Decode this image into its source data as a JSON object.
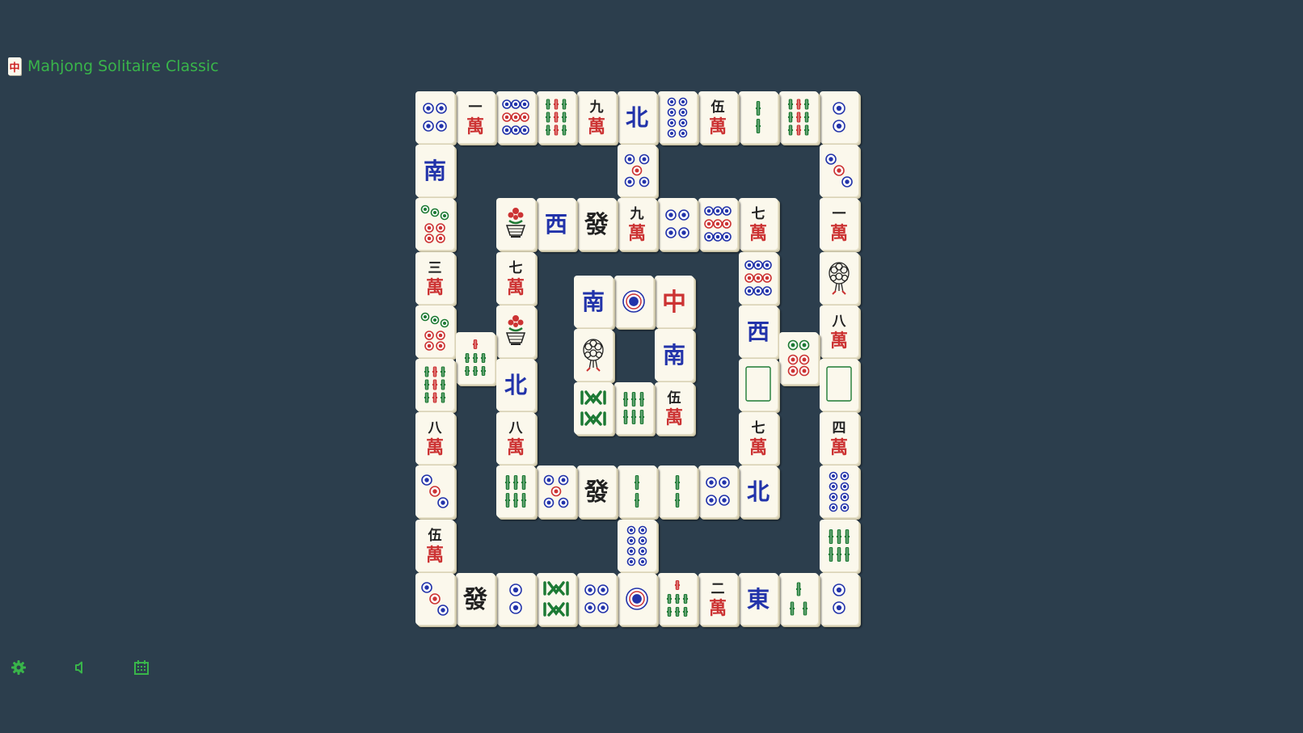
{
  "app": {
    "title": "Mahjong Solitaire Classic",
    "logo_glyph": "中",
    "logo_icon": "mahjong-red-dragon-logo-icon"
  },
  "colors": {
    "background": "#2c3e4d",
    "accent": "#39b54a",
    "tile_face": "#fbf8ec",
    "red": "#cc3333",
    "blue": "#2233aa",
    "green": "#1d7a34",
    "black": "#222222"
  },
  "toolbar": [
    {
      "name": "settings-button",
      "icon": "gear-icon"
    },
    {
      "name": "sound-button",
      "icon": "speaker-icon"
    },
    {
      "name": "calendar-button",
      "icon": "calendar-icon"
    }
  ],
  "tiles": [
    {
      "col": 0,
      "row": 0,
      "z": 0,
      "kind": "dots",
      "n": 4
    },
    {
      "col": 1,
      "row": 0,
      "z": 0,
      "kind": "char",
      "n": 1
    },
    {
      "col": 2,
      "row": 0,
      "z": 0,
      "kind": "dots",
      "n": 9
    },
    {
      "col": 3,
      "row": 0,
      "z": 0,
      "kind": "bam",
      "n": 9
    },
    {
      "col": 4,
      "row": 0,
      "z": 0,
      "kind": "char",
      "n": 9
    },
    {
      "col": 5,
      "row": 0,
      "z": 0,
      "kind": "wind",
      "g": "北"
    },
    {
      "col": 6,
      "row": 0,
      "z": 0,
      "kind": "dots",
      "n": 8
    },
    {
      "col": 7,
      "row": 0,
      "z": 0,
      "kind": "char",
      "n": 5
    },
    {
      "col": 8,
      "row": 0,
      "z": 0,
      "kind": "bam",
      "n": 2
    },
    {
      "col": 9,
      "row": 0,
      "z": 0,
      "kind": "bam",
      "n": 9
    },
    {
      "col": 10,
      "row": 0,
      "z": 0,
      "kind": "dots",
      "n": 2
    },
    {
      "col": 0,
      "row": 1,
      "z": 0,
      "kind": "wind",
      "g": "南"
    },
    {
      "col": 5,
      "row": 1,
      "z": 0,
      "kind": "dots",
      "n": 5
    },
    {
      "col": 10,
      "row": 1,
      "z": 0,
      "kind": "dots",
      "n": 3
    },
    {
      "col": 0,
      "row": 2,
      "z": 0,
      "kind": "dots",
      "n": 7
    },
    {
      "col": 2,
      "row": 2,
      "z": 0,
      "kind": "flower",
      "v": "basket"
    },
    {
      "col": 3,
      "row": 2,
      "z": 0,
      "kind": "wind",
      "g": "西"
    },
    {
      "col": 4,
      "row": 2,
      "z": 0,
      "kind": "dragon",
      "c": "green"
    },
    {
      "col": 5,
      "row": 2,
      "z": 0,
      "kind": "char",
      "n": 9
    },
    {
      "col": 6,
      "row": 2,
      "z": 0,
      "kind": "dots",
      "n": 4
    },
    {
      "col": 7,
      "row": 2,
      "z": 0,
      "kind": "dots",
      "n": 9
    },
    {
      "col": 8,
      "row": 2,
      "z": 0,
      "kind": "char",
      "n": 7
    },
    {
      "col": 10,
      "row": 2,
      "z": 0,
      "kind": "char",
      "n": 1
    },
    {
      "col": 0,
      "row": 3,
      "z": 0,
      "kind": "char",
      "n": 3
    },
    {
      "col": 2,
      "row": 3,
      "z": 0,
      "kind": "char",
      "n": 7
    },
    {
      "col": 8,
      "row": 3,
      "z": 0,
      "kind": "dots",
      "n": 9
    },
    {
      "col": 10,
      "row": 3,
      "z": 0,
      "kind": "flower",
      "v": "tree"
    },
    {
      "col": 0,
      "row": 4,
      "z": 0,
      "kind": "dots",
      "n": 7
    },
    {
      "col": 2,
      "row": 4,
      "z": 0,
      "kind": "flower",
      "v": "basket"
    },
    {
      "col": 8,
      "row": 4,
      "z": 0,
      "kind": "wind",
      "g": "西"
    },
    {
      "col": 10,
      "row": 4,
      "z": 0,
      "kind": "char",
      "n": 8
    },
    {
      "col": 0,
      "row": 5,
      "z": 0,
      "kind": "bam",
      "n": 9
    },
    {
      "col": 2,
      "row": 5,
      "z": 0,
      "kind": "wind",
      "g": "北"
    },
    {
      "col": 8,
      "row": 5,
      "z": 0,
      "kind": "dragon",
      "c": "white"
    },
    {
      "col": 10,
      "row": 5,
      "z": 0,
      "kind": "dragon",
      "c": "white"
    },
    {
      "col": 0,
      "row": 6,
      "z": 0,
      "kind": "char",
      "n": 8
    },
    {
      "col": 2,
      "row": 6,
      "z": 0,
      "kind": "char",
      "n": 8
    },
    {
      "col": 8,
      "row": 6,
      "z": 0,
      "kind": "char",
      "n": 7
    },
    {
      "col": 10,
      "row": 6,
      "z": 0,
      "kind": "char",
      "n": 4
    },
    {
      "col": 0,
      "row": 7,
      "z": 0,
      "kind": "dots",
      "n": 3
    },
    {
      "col": 2,
      "row": 7,
      "z": 0,
      "kind": "bam",
      "n": 6
    },
    {
      "col": 3,
      "row": 7,
      "z": 0,
      "kind": "dots",
      "n": 5
    },
    {
      "col": 4,
      "row": 7,
      "z": 0,
      "kind": "dragon",
      "c": "green"
    },
    {
      "col": 5,
      "row": 7,
      "z": 0,
      "kind": "bam",
      "n": 2
    },
    {
      "col": 6,
      "row": 7,
      "z": 0,
      "kind": "bam",
      "n": 2
    },
    {
      "col": 7,
      "row": 7,
      "z": 0,
      "kind": "dots",
      "n": 4
    },
    {
      "col": 8,
      "row": 7,
      "z": 0,
      "kind": "wind",
      "g": "北"
    },
    {
      "col": 10,
      "row": 7,
      "z": 0,
      "kind": "dots",
      "n": 8
    },
    {
      "col": 0,
      "row": 8,
      "z": 0,
      "kind": "char",
      "n": 5
    },
    {
      "col": 5,
      "row": 8,
      "z": 0,
      "kind": "dots",
      "n": 8
    },
    {
      "col": 10,
      "row": 8,
      "z": 0,
      "kind": "bam",
      "n": 6
    },
    {
      "col": 0,
      "row": 9,
      "z": 0,
      "kind": "dots",
      "n": 3
    },
    {
      "col": 1,
      "row": 9,
      "z": 0,
      "kind": "dragon",
      "c": "green"
    },
    {
      "col": 2,
      "row": 9,
      "z": 0,
      "kind": "dots",
      "n": 2
    },
    {
      "col": 3,
      "row": 9,
      "z": 0,
      "kind": "bam",
      "n": 8
    },
    {
      "col": 4,
      "row": 9,
      "z": 0,
      "kind": "dots",
      "n": 4
    },
    {
      "col": 5,
      "row": 9,
      "z": 0,
      "kind": "dots",
      "n": 1
    },
    {
      "col": 6,
      "row": 9,
      "z": 0,
      "kind": "bam",
      "n": 7
    },
    {
      "col": 7,
      "row": 9,
      "z": 0,
      "kind": "char",
      "n": 2
    },
    {
      "col": 8,
      "row": 9,
      "z": 0,
      "kind": "wind",
      "g": "東"
    },
    {
      "col": 9,
      "row": 9,
      "z": 0,
      "kind": "bam",
      "n": 3
    },
    {
      "col": 10,
      "row": 9,
      "z": 0,
      "kind": "dots",
      "n": 2
    },
    {
      "col": 1,
      "row": 4.5,
      "z": 0,
      "kind": "bam",
      "n": 7
    },
    {
      "col": 9,
      "row": 4.5,
      "z": 0,
      "kind": "dots",
      "n": 6
    },
    {
      "col": 4,
      "row": 3.5,
      "z": 1,
      "kind": "wind",
      "g": "南"
    },
    {
      "col": 5,
      "row": 3.5,
      "z": 1,
      "kind": "dots",
      "n": 1
    },
    {
      "col": 6,
      "row": 3.5,
      "z": 1,
      "kind": "dragon",
      "c": "red"
    },
    {
      "col": 4,
      "row": 4.5,
      "z": 1,
      "kind": "flower",
      "v": "tree"
    },
    {
      "col": 6,
      "row": 4.5,
      "z": 1,
      "kind": "wind",
      "g": "南"
    },
    {
      "col": 4,
      "row": 5.5,
      "z": 1,
      "kind": "bam",
      "n": 8
    },
    {
      "col": 5,
      "row": 5.5,
      "z": 1,
      "kind": "bam",
      "n": 6
    },
    {
      "col": 6,
      "row": 5.5,
      "z": 1,
      "kind": "char",
      "n": 5
    }
  ]
}
